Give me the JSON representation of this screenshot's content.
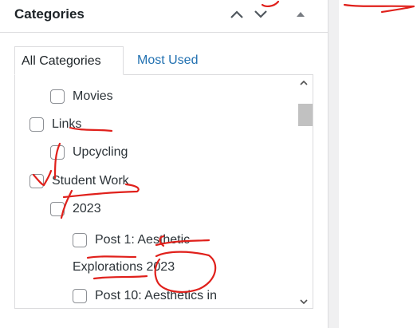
{
  "panel": {
    "title": "Categories",
    "controls": [
      "move-up",
      "move-down",
      "collapse"
    ]
  },
  "tabs": [
    {
      "label": "All Categories",
      "active": true
    },
    {
      "label": "Most Used",
      "active": false
    }
  ],
  "categories": [
    {
      "label": "Movies",
      "checked": false,
      "level": 1
    },
    {
      "label": "Links",
      "checked": false,
      "level": 0
    },
    {
      "label": "Upcycling",
      "checked": false,
      "level": 1
    },
    {
      "label": "Student Work",
      "checked": false,
      "level": 0
    },
    {
      "label": "2023",
      "checked": false,
      "level": 1
    },
    {
      "label": "Post 1: Aesthetic",
      "checked": false,
      "level": 2
    },
    {
      "label": "Explorations 2023",
      "checked": false,
      "level": 2,
      "continuation": true
    },
    {
      "label": "Post 10: Aesthetics in",
      "checked": false,
      "level": 2
    }
  ],
  "colors": {
    "accent": "#2271b1",
    "annotation": "#e0201b",
    "border": "#dcdcde"
  },
  "icons": [
    "chevron-up-icon",
    "chevron-down-icon",
    "triangle-up-icon",
    "scroll-up-arrow-icon",
    "scroll-down-arrow-icon"
  ]
}
